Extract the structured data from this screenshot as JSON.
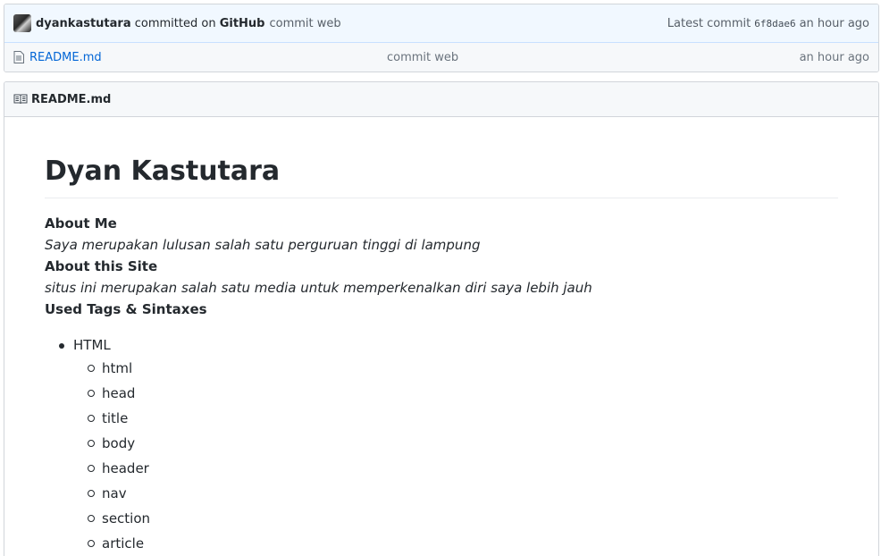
{
  "commit": {
    "author": "dyankastutara",
    "action": "committed on",
    "platform": "GitHub",
    "message": "commit web",
    "latest_label": "Latest commit",
    "sha": "6f8dae6",
    "age": "an hour ago"
  },
  "file": {
    "name": "README.md",
    "message": "commit web",
    "age": "an hour ago"
  },
  "readme": {
    "header": "README.md",
    "title": "Dyan Kastutara",
    "about_me_title": "About Me",
    "about_me_text": "Saya merupakan lulusan salah satu perguruan tinggi di lampung",
    "about_site_title": "About this Site",
    "about_site_text": "situs ini merupakan salah satu media untuk memperkenalkan diri saya lebih jauh",
    "tags_title": "Used Tags & Sintaxes",
    "tags": [
      {
        "label": "HTML",
        "items": [
          "html",
          "head",
          "title",
          "body",
          "header",
          "nav",
          "section",
          "article"
        ]
      }
    ]
  },
  "icons": {
    "file": "file-icon",
    "book": "book-icon",
    "avatar": "avatar"
  }
}
